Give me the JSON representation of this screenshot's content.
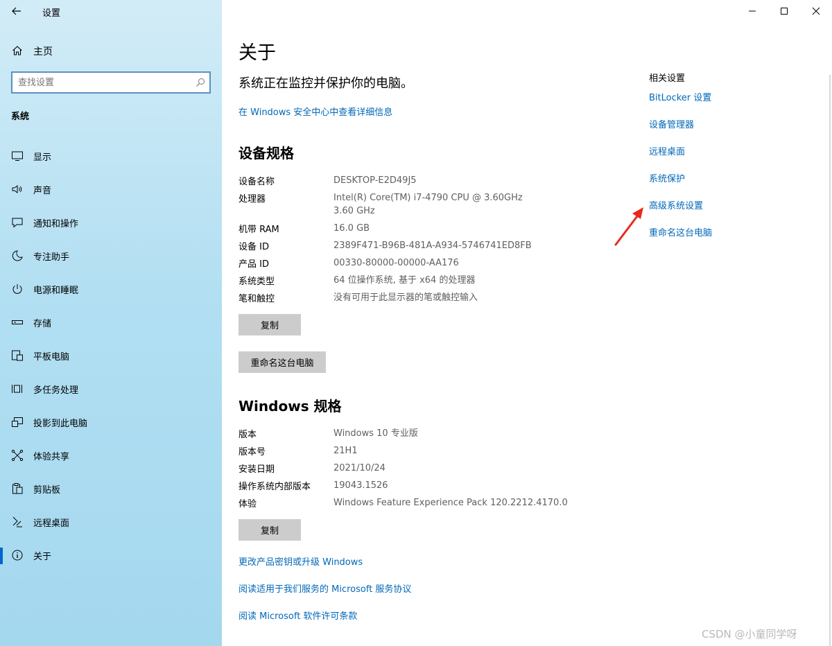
{
  "app": {
    "title": "设置"
  },
  "sidebar": {
    "home_label": "主页",
    "search_placeholder": "查找设置",
    "section_title": "系统",
    "items": [
      {
        "label": "显示",
        "icon": "display-icon"
      },
      {
        "label": "声音",
        "icon": "speaker-icon"
      },
      {
        "label": "通知和操作",
        "icon": "notification-icon"
      },
      {
        "label": "专注助手",
        "icon": "moon-icon"
      },
      {
        "label": "电源和睡眠",
        "icon": "power-icon"
      },
      {
        "label": "存储",
        "icon": "storage-icon"
      },
      {
        "label": "平板电脑",
        "icon": "tablet-icon"
      },
      {
        "label": "多任务处理",
        "icon": "multitask-icon"
      },
      {
        "label": "投影到此电脑",
        "icon": "project-icon"
      },
      {
        "label": "体验共享",
        "icon": "share-icon"
      },
      {
        "label": "剪贴板",
        "icon": "clipboard-icon"
      },
      {
        "label": "远程桌面",
        "icon": "remote-icon"
      },
      {
        "label": "关于",
        "icon": "info-icon",
        "selected": true
      }
    ]
  },
  "main": {
    "title": "关于",
    "protect_text": "系统正在监控并保护你的电脑。",
    "security_link": "在 Windows 安全中心中查看详细信息",
    "device_spec_title": "设备规格",
    "device_specs": [
      {
        "key": "设备名称",
        "value": "DESKTOP-E2D49J5"
      },
      {
        "key": "处理器",
        "value": "Intel(R) Core(TM) i7-4790 CPU @ 3.60GHz   3.60 GHz"
      },
      {
        "key": "机带 RAM",
        "value": "16.0 GB"
      },
      {
        "key": "设备 ID",
        "value": "2389F471-B96B-481A-A934-5746741ED8FB"
      },
      {
        "key": "产品 ID",
        "value": "00330-80000-00000-AA176"
      },
      {
        "key": "系统类型",
        "value": "64 位操作系统, 基于 x64 的处理器"
      },
      {
        "key": "笔和触控",
        "value": "没有可用于此显示器的笔或触控输入"
      }
    ],
    "copy_label": "复制",
    "rename_label": "重命名这台电脑",
    "windows_spec_title": "Windows 规格",
    "windows_specs": [
      {
        "key": "版本",
        "value": "Windows 10 专业版"
      },
      {
        "key": "版本号",
        "value": "21H1"
      },
      {
        "key": "安装日期",
        "value": "2021/10/24"
      },
      {
        "key": "操作系统内部版本",
        "value": "19043.1526"
      },
      {
        "key": "体验",
        "value": "Windows Feature Experience Pack 120.2212.4170.0"
      }
    ],
    "copy2_label": "复制",
    "links": [
      "更改产品密钥或升级 Windows",
      "阅读适用于我们服务的 Microsoft 服务协议",
      "阅读 Microsoft 软件许可条款"
    ]
  },
  "related": {
    "title": "相关设置",
    "links": [
      "BitLocker 设置",
      "设备管理器",
      "远程桌面",
      "系统保护",
      "高级系统设置",
      "重命名这台电脑"
    ]
  },
  "watermark": "CSDN @小童同学呀",
  "colors": {
    "link": "#0067b8",
    "accent": "#0066cc",
    "arrow": "#e8291c",
    "button": "#cccccc"
  }
}
